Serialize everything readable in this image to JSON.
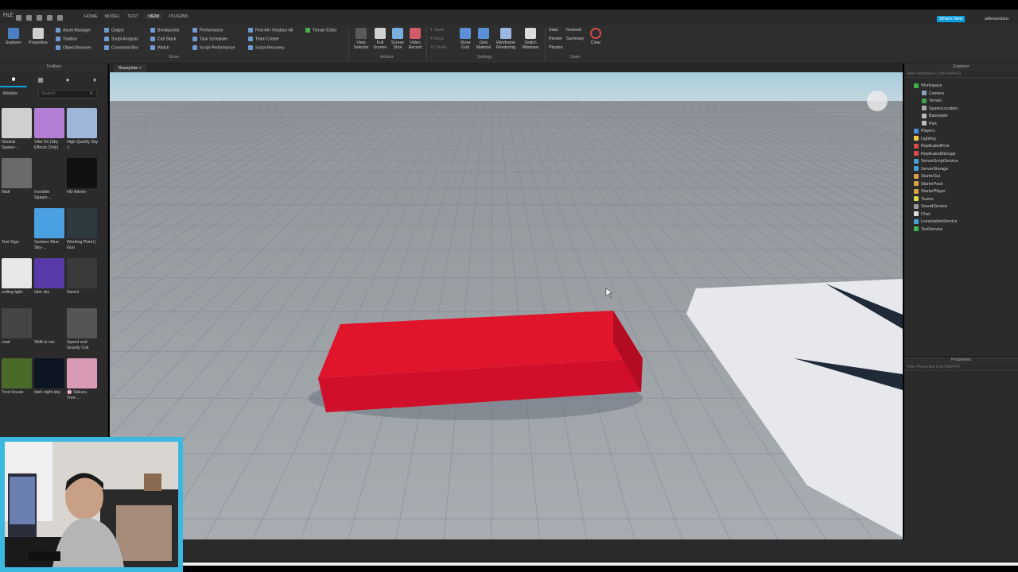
{
  "titlebar": {
    "file_label": "FILE",
    "tabs": [
      "HOME",
      "MODEL",
      "TEST",
      "VIEW",
      "PLUGINS"
    ],
    "active_tab": "VIEW",
    "whats_new": "What's New",
    "username": "adlexandaru"
  },
  "ribbon": {
    "explorer": "Explorer",
    "properties": "Properties",
    "show_items": [
      "Asset Manager",
      "Toolbox",
      "Object Browser",
      "Output",
      "Script Analysis",
      "Command Bar",
      "Breakpoints",
      "Call Stack",
      "Watch",
      "Performance",
      "Task Scheduler",
      "Script Performance",
      "Find All / Replace All",
      "Team Create",
      "Script Recovery",
      "Terrain Editor"
    ],
    "group_show": "Show",
    "view_selector": "View Selector",
    "full_screen": "Full Screen",
    "screen_shot": "Screen Shot",
    "video_record": "Video Record",
    "group_actions": "Actions",
    "studs": [
      "1 Studs",
      "4 Studs",
      "16 Studs"
    ],
    "show_grid": "Show Grid",
    "grid_material": "Grid Material",
    "wireframe_rendering": "Wireframe Rendering",
    "switch_windows": "Switch Windows",
    "group_settings": "Settings",
    "stats_items": [
      "Stats",
      "Render",
      "Physics",
      "Network",
      "Summary"
    ],
    "clear": "Clear",
    "group_stats": "Stats"
  },
  "toolbox": {
    "title": "Toolbox",
    "category": "Models",
    "search_placeholder": "Search",
    "models": [
      {
        "label": "Neutral Spawn-...",
        "color": "#cfcfcf"
      },
      {
        "label": "Vibe Kit (Sky Effects Only)",
        "color": "#b37fd6"
      },
      {
        "label": "High Quality Sky :)",
        "color": "#9eb7d9"
      },
      {
        "label": "Wall",
        "color": "#6a6a6a"
      },
      {
        "label": "Invisible Spawn-...",
        "color": "#2b2b2b"
      },
      {
        "label": "HD Admin",
        "color": "#111111"
      },
      {
        "label": "Text Sign",
        "color": "#2b2b2b"
      },
      {
        "label": "Sunless Blue Sky-...",
        "color": "#4aa0e0"
      },
      {
        "label": "Working Pistol | Gun",
        "color": "#2f3a40"
      },
      {
        "label": "ceiling light",
        "color": "#e8e8e8"
      },
      {
        "label": "vibe sky",
        "color": "#5a3aa8"
      },
      {
        "label": "Sword",
        "color": "#3a3a3a"
      },
      {
        "label": "road",
        "color": "#444444"
      },
      {
        "label": "Shift to run",
        "color": "#2b2b2b"
      },
      {
        "label": "Speed and Gravity Coil",
        "color": "#555555"
      },
      {
        "label": "Tree House",
        "color": "#4a6a2a"
      },
      {
        "label": "dark night sky-",
        "color": "#0d1522"
      },
      {
        "label": "🌸 Sakura Tree-...",
        "color": "#d99ab6"
      }
    ]
  },
  "viewport": {
    "tab_label": "Baseplate"
  },
  "explorer": {
    "title": "Explorer",
    "filter": "Filter workspace (Ctrl+Shift+X)",
    "items": [
      {
        "label": "Workspace",
        "depth": 0,
        "color": "#3fb34f"
      },
      {
        "label": "Camera",
        "depth": 1,
        "color": "#8aa0b8"
      },
      {
        "label": "Terrain",
        "depth": 1,
        "color": "#3fa34f"
      },
      {
        "label": "SpawnLocation",
        "depth": 1,
        "color": "#aaaaaa"
      },
      {
        "label": "Baseplate",
        "depth": 1,
        "color": "#bbbbbb"
      },
      {
        "label": "Part",
        "depth": 1,
        "color": "#bbbbbb"
      },
      {
        "label": "Players",
        "depth": 0,
        "color": "#4a8fd9"
      },
      {
        "label": "Lighting",
        "depth": 0,
        "color": "#f2c94c"
      },
      {
        "label": "ReplicatedFirst",
        "depth": 0,
        "color": "#d94a4a"
      },
      {
        "label": "ReplicatedStorage",
        "depth": 0,
        "color": "#d94a4a"
      },
      {
        "label": "ServerScriptService",
        "depth": 0,
        "color": "#4a9fd9"
      },
      {
        "label": "ServerStorage",
        "depth": 0,
        "color": "#4a9fd9"
      },
      {
        "label": "StarterGui",
        "depth": 0,
        "color": "#d9a04a"
      },
      {
        "label": "StarterPack",
        "depth": 0,
        "color": "#d9a04a"
      },
      {
        "label": "StarterPlayer",
        "depth": 0,
        "color": "#d9a04a"
      },
      {
        "label": "Teams",
        "depth": 0,
        "color": "#d9d94a"
      },
      {
        "label": "SoundService",
        "depth": 0,
        "color": "#999999"
      },
      {
        "label": "Chat",
        "depth": 0,
        "color": "#dddddd"
      },
      {
        "label": "LocalizationService",
        "depth": 0,
        "color": "#4a9fd9"
      },
      {
        "label": "TestService",
        "depth": 0,
        "color": "#3fb34f"
      }
    ]
  },
  "properties": {
    "title": "Properties",
    "filter": "Filter Properties (Ctrl+Shift+P)"
  }
}
